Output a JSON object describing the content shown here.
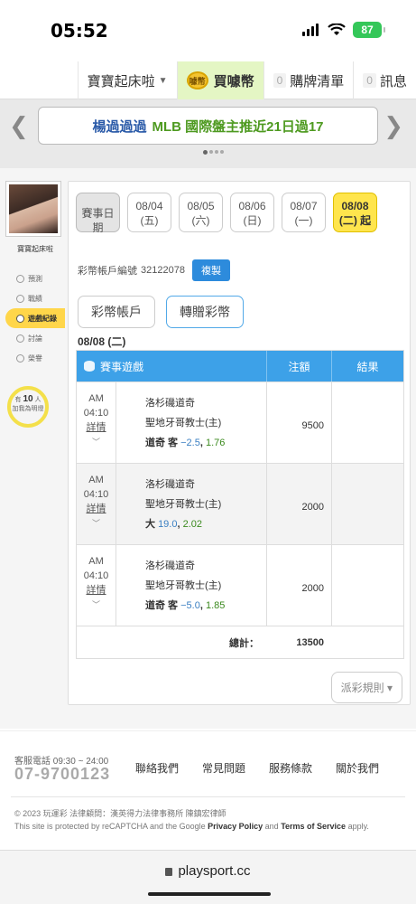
{
  "status": {
    "time": "05:52",
    "battery": "87"
  },
  "topnav": {
    "user": "寶寶起床啦",
    "buy": "買噱幣",
    "buy_icon_text": "噱幣",
    "cart_count": "0",
    "cart": "購牌清單",
    "msg_count": "0",
    "msg": "訊息"
  },
  "banner": {
    "part1": "楊過過過",
    "part2": "MLB 國際盤主推近21日過17"
  },
  "sidebar": {
    "username": "寶寶起床啦",
    "items": [
      {
        "label": "預測"
      },
      {
        "label": "戰績"
      },
      {
        "label": "遊戲紀錄"
      },
      {
        "label": "討論"
      },
      {
        "label": "榮譽"
      }
    ],
    "followers_pre": "有",
    "followers_count": "10",
    "followers_unit": "人",
    "followers_post": "加我為明燈"
  },
  "dates": {
    "label": "賽事日期",
    "items": [
      {
        "date": "08/04",
        "day": "(五)"
      },
      {
        "date": "08/05",
        "day": "(六)"
      },
      {
        "date": "08/06",
        "day": "(日)"
      },
      {
        "date": "08/07",
        "day": "(一)"
      },
      {
        "date": "08/08",
        "day": "(二) 起"
      }
    ]
  },
  "account": {
    "label": "彩幣帳戶編號",
    "number": "32122078",
    "copy": "複製"
  },
  "tabs": {
    "a": "彩幣帳戶",
    "b": "轉贈彩幣"
  },
  "current_date": "08/08 (二)",
  "table": {
    "headers": {
      "game": "賽事遊戲",
      "amount": "注額",
      "result": "結果"
    },
    "rows": [
      {
        "ampm": "AM",
        "time": "04:10",
        "detail": "詳情",
        "away": "洛杉磯道奇",
        "home": "聖地牙哥教士(主)",
        "pick": "道奇 客",
        "odds1": "−2.5",
        "odds2": "1.76",
        "amount": "9500"
      },
      {
        "ampm": "AM",
        "time": "04:10",
        "detail": "詳情",
        "away": "洛杉磯道奇",
        "home": "聖地牙哥教士(主)",
        "pick": "大",
        "odds1": "19.0",
        "odds2": "2.02",
        "amount": "2000"
      },
      {
        "ampm": "AM",
        "time": "04:10",
        "detail": "詳情",
        "away": "洛杉磯道奇",
        "home": "聖地牙哥教士(主)",
        "pick": "道奇 客",
        "odds1": "−5.0",
        "odds2": "1.85",
        "amount": "2000"
      }
    ],
    "total_label": "總計：",
    "total_value": "13500"
  },
  "rules_button": "派彩規則 ▾",
  "footer": {
    "service_label": "客服電話 09:30 ~ 24:00",
    "phone": "07-9700123",
    "links": [
      "聯絡我們",
      "常見問題",
      "服務條款",
      "關於我們"
    ],
    "copyright": "© 2023 玩運彩 法律顧問：漢英得力法律事務所 陳鎮宏律師",
    "recaptcha_pre": "This site is protected by reCAPTCHA and the Google ",
    "privacy": "Privacy Policy",
    "and": " and ",
    "terms": "Terms of Service",
    "apply": " apply."
  },
  "browser": {
    "url": "playsport.cc"
  }
}
